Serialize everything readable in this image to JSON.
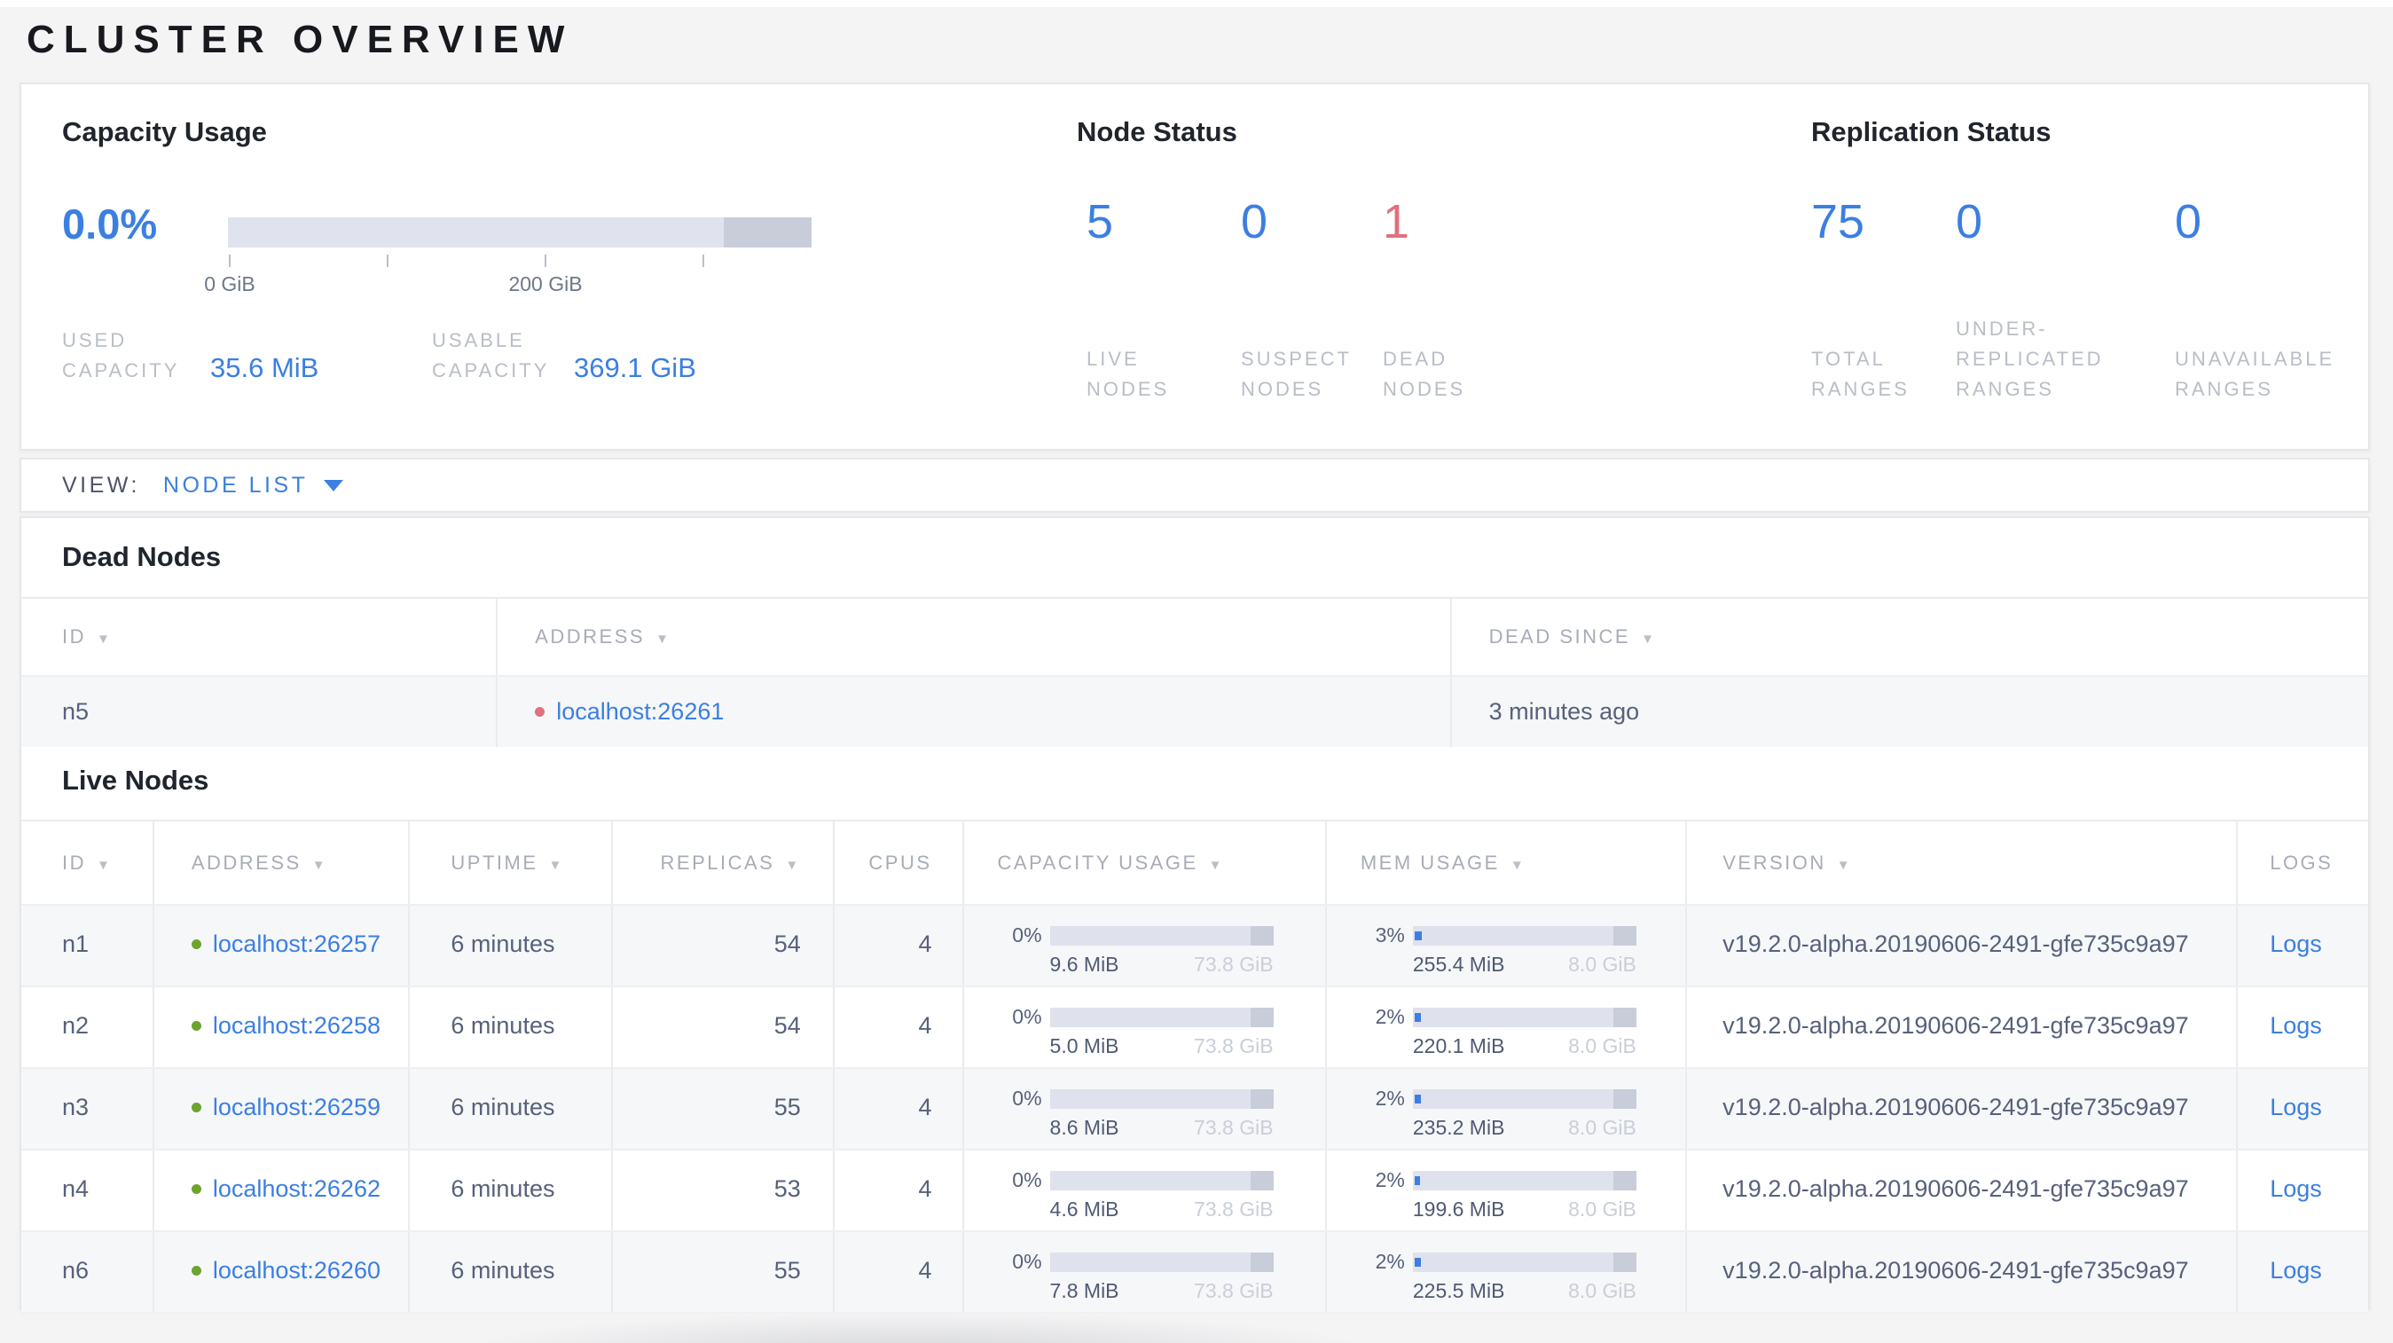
{
  "page_title": "CLUSTER OVERVIEW",
  "colors": {
    "accent_blue": "#3b7fe2",
    "dead_red": "#e0717f",
    "live_green": "#6ca42f"
  },
  "summary": {
    "capacity": {
      "title": "Capacity Usage",
      "percent": "0.0%",
      "fill_pct": 0,
      "axis_labels": [
        "0 GiB",
        "200 GiB"
      ],
      "used_label": "USED CAPACITY",
      "used_value": "35.6 MiB",
      "usable_label": "USABLE CAPACITY",
      "usable_value": "369.1 GiB"
    },
    "node_status": {
      "title": "Node Status",
      "stats": [
        {
          "value": "5",
          "label": "LIVE NODES"
        },
        {
          "value": "0",
          "label": "SUSPECT NODES"
        },
        {
          "value": "1",
          "label": "DEAD NODES"
        }
      ]
    },
    "replication": {
      "title": "Replication Status",
      "stats": [
        {
          "value": "75",
          "label": "TOTAL RANGES"
        },
        {
          "value": "0",
          "label": "UNDER-REPLICATED RANGES"
        },
        {
          "value": "0",
          "label": "UNAVAILABLE RANGES"
        }
      ]
    }
  },
  "view_bar": {
    "label": "VIEW:",
    "selected": "NODE LIST"
  },
  "dead_nodes": {
    "title": "Dead Nodes",
    "headers": {
      "id": "ID",
      "address": "ADDRESS",
      "dead_since": "DEAD SINCE"
    },
    "rows": [
      {
        "id": "n5",
        "address": "localhost:26261",
        "dead_since": "3 minutes ago"
      }
    ]
  },
  "live_nodes": {
    "title": "Live Nodes",
    "headers": {
      "id": "ID",
      "address": "ADDRESS",
      "uptime": "UPTIME",
      "replicas": "REPLICAS",
      "cpus": "CPUS",
      "capacity": "CAPACITY USAGE",
      "mem": "MEM USAGE",
      "version": "VERSION",
      "logs": "LOGS"
    },
    "rows": [
      {
        "id": "n1",
        "address": "localhost:26257",
        "uptime": "6 minutes",
        "replicas": "54",
        "cpus": "4",
        "capacity": {
          "percent": "0%",
          "fill_pct": 0,
          "used": "9.6 MiB",
          "total": "73.8 GiB"
        },
        "mem": {
          "percent": "3%",
          "fill_pct": 3.1,
          "used": "255.4 MiB",
          "total": "8.0 GiB"
        },
        "version": "v19.2.0-alpha.20190606-2491-gfe735c9a97",
        "logs_label": "Logs"
      },
      {
        "id": "n2",
        "address": "localhost:26258",
        "uptime": "6 minutes",
        "replicas": "54",
        "cpus": "4",
        "capacity": {
          "percent": "0%",
          "fill_pct": 0,
          "used": "5.0 MiB",
          "total": "73.8 GiB"
        },
        "mem": {
          "percent": "2%",
          "fill_pct": 2.7,
          "used": "220.1 MiB",
          "total": "8.0 GiB"
        },
        "version": "v19.2.0-alpha.20190606-2491-gfe735c9a97",
        "logs_label": "Logs"
      },
      {
        "id": "n3",
        "address": "localhost:26259",
        "uptime": "6 minutes",
        "replicas": "55",
        "cpus": "4",
        "capacity": {
          "percent": "0%",
          "fill_pct": 0,
          "used": "8.6 MiB",
          "total": "73.8 GiB"
        },
        "mem": {
          "percent": "2%",
          "fill_pct": 2.9,
          "used": "235.2 MiB",
          "total": "8.0 GiB"
        },
        "version": "v19.2.0-alpha.20190606-2491-gfe735c9a97",
        "logs_label": "Logs"
      },
      {
        "id": "n4",
        "address": "localhost:26262",
        "uptime": "6 minutes",
        "replicas": "53",
        "cpus": "4",
        "capacity": {
          "percent": "0%",
          "fill_pct": 0,
          "used": "4.6 MiB",
          "total": "73.8 GiB"
        },
        "mem": {
          "percent": "2%",
          "fill_pct": 2.4,
          "used": "199.6 MiB",
          "total": "8.0 GiB"
        },
        "version": "v19.2.0-alpha.20190606-2491-gfe735c9a97",
        "logs_label": "Logs"
      },
      {
        "id": "n6",
        "address": "localhost:26260",
        "uptime": "6 minutes",
        "replicas": "55",
        "cpus": "4",
        "capacity": {
          "percent": "0%",
          "fill_pct": 0,
          "used": "7.8 MiB",
          "total": "73.8 GiB"
        },
        "mem": {
          "percent": "2%",
          "fill_pct": 2.8,
          "used": "225.5 MiB",
          "total": "8.0 GiB"
        },
        "version": "v19.2.0-alpha.20190606-2491-gfe735c9a97",
        "logs_label": "Logs"
      }
    ]
  }
}
